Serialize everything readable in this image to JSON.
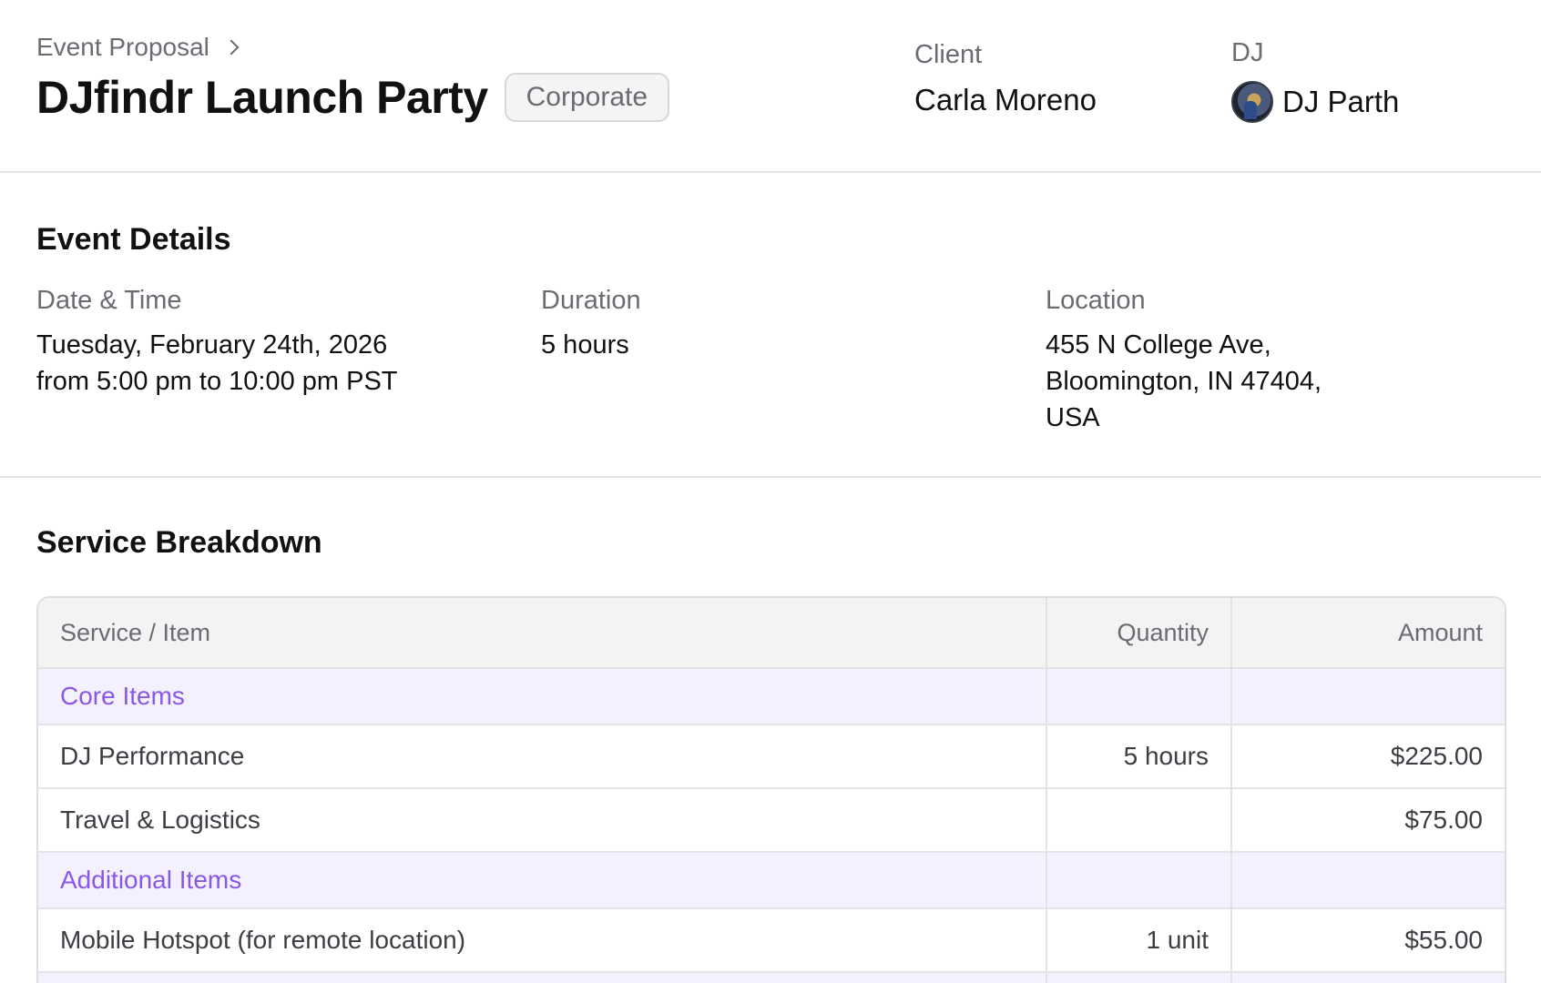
{
  "breadcrumb": "Event Proposal",
  "event_title": "DJfindr Launch Party",
  "event_type_badge": "Corporate",
  "client": {
    "label": "Client",
    "name": "Carla Moreno"
  },
  "dj": {
    "label": "DJ",
    "name": "DJ Parth"
  },
  "event_details": {
    "title": "Event Details",
    "date_time": {
      "label": "Date & Time",
      "line1": "Tuesday, February 24th, 2026",
      "line2": "from 5:00 pm to 10:00 pm PST"
    },
    "duration": {
      "label": "Duration",
      "value": "5 hours"
    },
    "location": {
      "label": "Location",
      "line1": "455 N College Ave,",
      "line2": "Bloomington, IN 47404,",
      "line3": "USA"
    }
  },
  "service_breakdown": {
    "title": "Service Breakdown",
    "columns": {
      "service": "Service / Item",
      "quantity": "Quantity",
      "amount": "Amount"
    },
    "groups": [
      {
        "name": "Core Items",
        "items": [
          {
            "service": "DJ Performance",
            "quantity": "5 hours",
            "amount": "$225.00"
          },
          {
            "service": "Travel & Logistics",
            "quantity": "",
            "amount": "$75.00"
          }
        ]
      },
      {
        "name": "Additional Items",
        "items": [
          {
            "service": "Mobile Hotspot (for remote location)",
            "quantity": "1 unit",
            "amount": "$55.00"
          }
        ]
      }
    ]
  }
}
